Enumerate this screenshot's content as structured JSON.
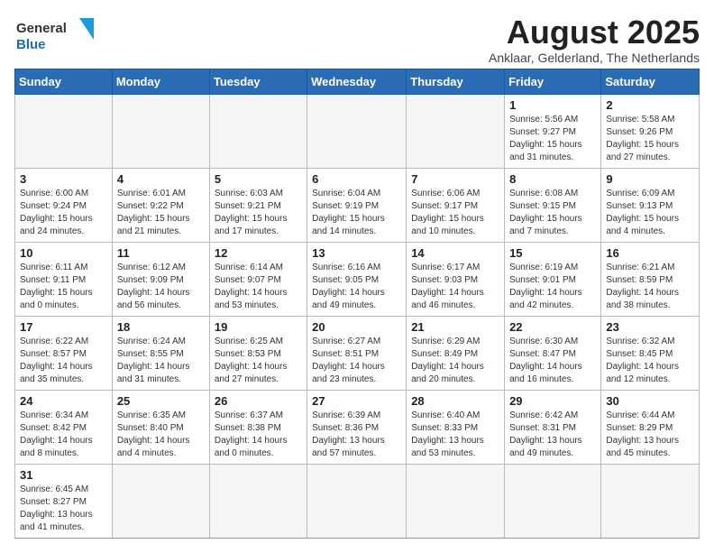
{
  "logo": {
    "text_general": "General",
    "text_blue": "Blue"
  },
  "title": "August 2025",
  "subtitle": "Anklaar, Gelderland, The Netherlands",
  "days_of_week": [
    "Sunday",
    "Monday",
    "Tuesday",
    "Wednesday",
    "Thursday",
    "Friday",
    "Saturday"
  ],
  "weeks": [
    [
      {
        "day": "",
        "info": ""
      },
      {
        "day": "",
        "info": ""
      },
      {
        "day": "",
        "info": ""
      },
      {
        "day": "",
        "info": ""
      },
      {
        "day": "",
        "info": ""
      },
      {
        "day": "1",
        "info": "Sunrise: 5:56 AM\nSunset: 9:27 PM\nDaylight: 15 hours\nand 31 minutes."
      },
      {
        "day": "2",
        "info": "Sunrise: 5:58 AM\nSunset: 9:26 PM\nDaylight: 15 hours\nand 27 minutes."
      }
    ],
    [
      {
        "day": "3",
        "info": "Sunrise: 6:00 AM\nSunset: 9:24 PM\nDaylight: 15 hours\nand 24 minutes."
      },
      {
        "day": "4",
        "info": "Sunrise: 6:01 AM\nSunset: 9:22 PM\nDaylight: 15 hours\nand 21 minutes."
      },
      {
        "day": "5",
        "info": "Sunrise: 6:03 AM\nSunset: 9:21 PM\nDaylight: 15 hours\nand 17 minutes."
      },
      {
        "day": "6",
        "info": "Sunrise: 6:04 AM\nSunset: 9:19 PM\nDaylight: 15 hours\nand 14 minutes."
      },
      {
        "day": "7",
        "info": "Sunrise: 6:06 AM\nSunset: 9:17 PM\nDaylight: 15 hours\nand 10 minutes."
      },
      {
        "day": "8",
        "info": "Sunrise: 6:08 AM\nSunset: 9:15 PM\nDaylight: 15 hours\nand 7 minutes."
      },
      {
        "day": "9",
        "info": "Sunrise: 6:09 AM\nSunset: 9:13 PM\nDaylight: 15 hours\nand 4 minutes."
      }
    ],
    [
      {
        "day": "10",
        "info": "Sunrise: 6:11 AM\nSunset: 9:11 PM\nDaylight: 15 hours\nand 0 minutes."
      },
      {
        "day": "11",
        "info": "Sunrise: 6:12 AM\nSunset: 9:09 PM\nDaylight: 14 hours\nand 56 minutes."
      },
      {
        "day": "12",
        "info": "Sunrise: 6:14 AM\nSunset: 9:07 PM\nDaylight: 14 hours\nand 53 minutes."
      },
      {
        "day": "13",
        "info": "Sunrise: 6:16 AM\nSunset: 9:05 PM\nDaylight: 14 hours\nand 49 minutes."
      },
      {
        "day": "14",
        "info": "Sunrise: 6:17 AM\nSunset: 9:03 PM\nDaylight: 14 hours\nand 46 minutes."
      },
      {
        "day": "15",
        "info": "Sunrise: 6:19 AM\nSunset: 9:01 PM\nDaylight: 14 hours\nand 42 minutes."
      },
      {
        "day": "16",
        "info": "Sunrise: 6:21 AM\nSunset: 8:59 PM\nDaylight: 14 hours\nand 38 minutes."
      }
    ],
    [
      {
        "day": "17",
        "info": "Sunrise: 6:22 AM\nSunset: 8:57 PM\nDaylight: 14 hours\nand 35 minutes."
      },
      {
        "day": "18",
        "info": "Sunrise: 6:24 AM\nSunset: 8:55 PM\nDaylight: 14 hours\nand 31 minutes."
      },
      {
        "day": "19",
        "info": "Sunrise: 6:25 AM\nSunset: 8:53 PM\nDaylight: 14 hours\nand 27 minutes."
      },
      {
        "day": "20",
        "info": "Sunrise: 6:27 AM\nSunset: 8:51 PM\nDaylight: 14 hours\nand 23 minutes."
      },
      {
        "day": "21",
        "info": "Sunrise: 6:29 AM\nSunset: 8:49 PM\nDaylight: 14 hours\nand 20 minutes."
      },
      {
        "day": "22",
        "info": "Sunrise: 6:30 AM\nSunset: 8:47 PM\nDaylight: 14 hours\nand 16 minutes."
      },
      {
        "day": "23",
        "info": "Sunrise: 6:32 AM\nSunset: 8:45 PM\nDaylight: 14 hours\nand 12 minutes."
      }
    ],
    [
      {
        "day": "24",
        "info": "Sunrise: 6:34 AM\nSunset: 8:42 PM\nDaylight: 14 hours\nand 8 minutes."
      },
      {
        "day": "25",
        "info": "Sunrise: 6:35 AM\nSunset: 8:40 PM\nDaylight: 14 hours\nand 4 minutes."
      },
      {
        "day": "26",
        "info": "Sunrise: 6:37 AM\nSunset: 8:38 PM\nDaylight: 14 hours\nand 0 minutes."
      },
      {
        "day": "27",
        "info": "Sunrise: 6:39 AM\nSunset: 8:36 PM\nDaylight: 13 hours\nand 57 minutes."
      },
      {
        "day": "28",
        "info": "Sunrise: 6:40 AM\nSunset: 8:33 PM\nDaylight: 13 hours\nand 53 minutes."
      },
      {
        "day": "29",
        "info": "Sunrise: 6:42 AM\nSunset: 8:31 PM\nDaylight: 13 hours\nand 49 minutes."
      },
      {
        "day": "30",
        "info": "Sunrise: 6:44 AM\nSunset: 8:29 PM\nDaylight: 13 hours\nand 45 minutes."
      }
    ],
    [
      {
        "day": "31",
        "info": "Sunrise: 6:45 AM\nSunset: 8:27 PM\nDaylight: 13 hours\nand 41 minutes."
      },
      {
        "day": "",
        "info": ""
      },
      {
        "day": "",
        "info": ""
      },
      {
        "day": "",
        "info": ""
      },
      {
        "day": "",
        "info": ""
      },
      {
        "day": "",
        "info": ""
      },
      {
        "day": "",
        "info": ""
      }
    ]
  ]
}
